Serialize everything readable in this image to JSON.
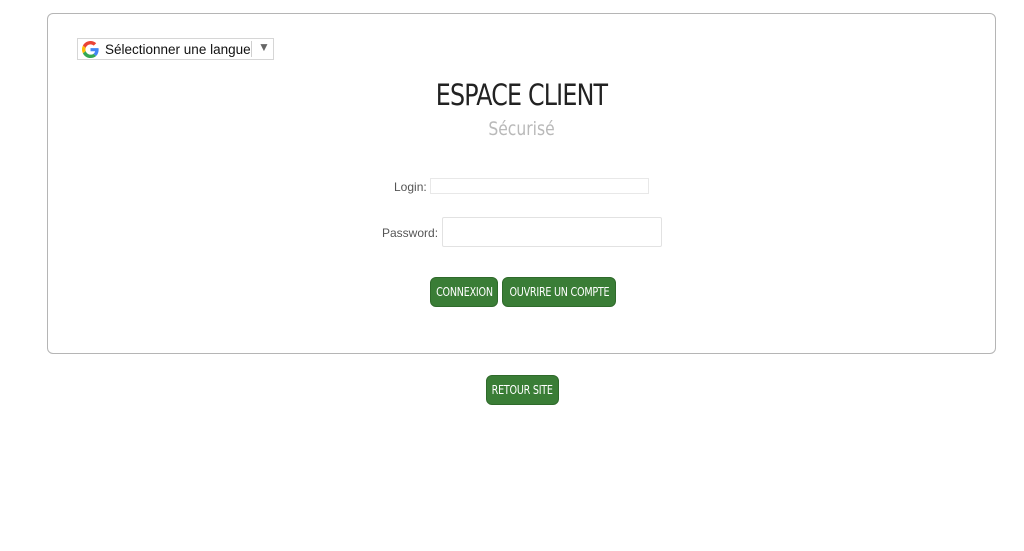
{
  "language": {
    "label": "Sélectionner une langue",
    "icon": "google-g-icon",
    "arrow": "▼"
  },
  "header": {
    "title": "ESPACE CLIENT",
    "subtitle": "Sécurisé"
  },
  "form": {
    "login_label": "Login:",
    "login_value": "",
    "password_label": "Password:",
    "password_value": ""
  },
  "buttons": {
    "connexion": "CONNEXION",
    "ouvrir_compte": "OUVRIRE UN COMPTE",
    "retour_site": "RETOUR SITE"
  },
  "colors": {
    "button_bg": "#3a7d36",
    "subtitle": "#b9b9b9"
  }
}
